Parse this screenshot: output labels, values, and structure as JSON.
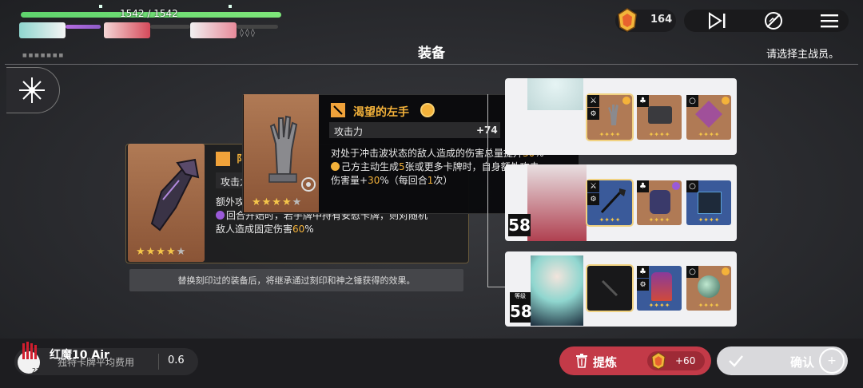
{
  "hud": {
    "hp_text": "1542 / 1542",
    "hp_fraction": 1.0,
    "currency_value": "164"
  },
  "header": {
    "title": "装备",
    "hint": "请选择主战员。",
    "tiny_label": "■ ■ ■ ■ ■ ■ ■"
  },
  "left_card": {
    "attr_label": "攻击力",
    "extra_label": "额外攻",
    "desc_line1_pre": "回合开始时，若手牌中持有安慰卡牌，则对随机",
    "desc_line2_pre": "敌人造成固定伤害",
    "desc_line2_hl": "60",
    "desc_line2_post": "%",
    "stars": "★★★★",
    "dim_star": "★",
    "title_fragment": "阝"
  },
  "replace_note": "替换刻印过的装备后，将继承通过刻印和神之锤获得的效果。",
  "tooltip": {
    "name": "渴望的左手",
    "attr_label": "攻击力",
    "attr_value": "+74",
    "line1_pre": "对处于冲击波状态的敌人造成的伤害总量提升",
    "line1_hl": "30",
    "line1_post": "%",
    "line2_pre": "己方主动生成",
    "line2_hl": "5",
    "line2_post": "张或更多卡牌时，自身额外攻击",
    "line3_pre": "伤害量+",
    "line3_hl": "30",
    "line3_mid": "%（每回合",
    "line3_hl2": "1",
    "line3_post": "次）",
    "stars": "★★★★",
    "dim_star": "★"
  },
  "panels": [
    {
      "level_label": "",
      "level": ""
    },
    {
      "level_label": "",
      "level": "58"
    },
    {
      "level_label": "等级",
      "level": "58"
    }
  ],
  "slot_stars": "✦✦✦✦",
  "bottom": {
    "device_name": "红魔10 Air",
    "cost_label": "独特卡牌平均费用",
    "cost_value": "0.6",
    "refine_label": "提炼",
    "refine_value": "+60",
    "confirm_label": "确认",
    "badge_num": "22"
  },
  "colors": {
    "highlight": "#f4b23a",
    "refine": "#c33a48",
    "hp": "#5fd36d"
  }
}
